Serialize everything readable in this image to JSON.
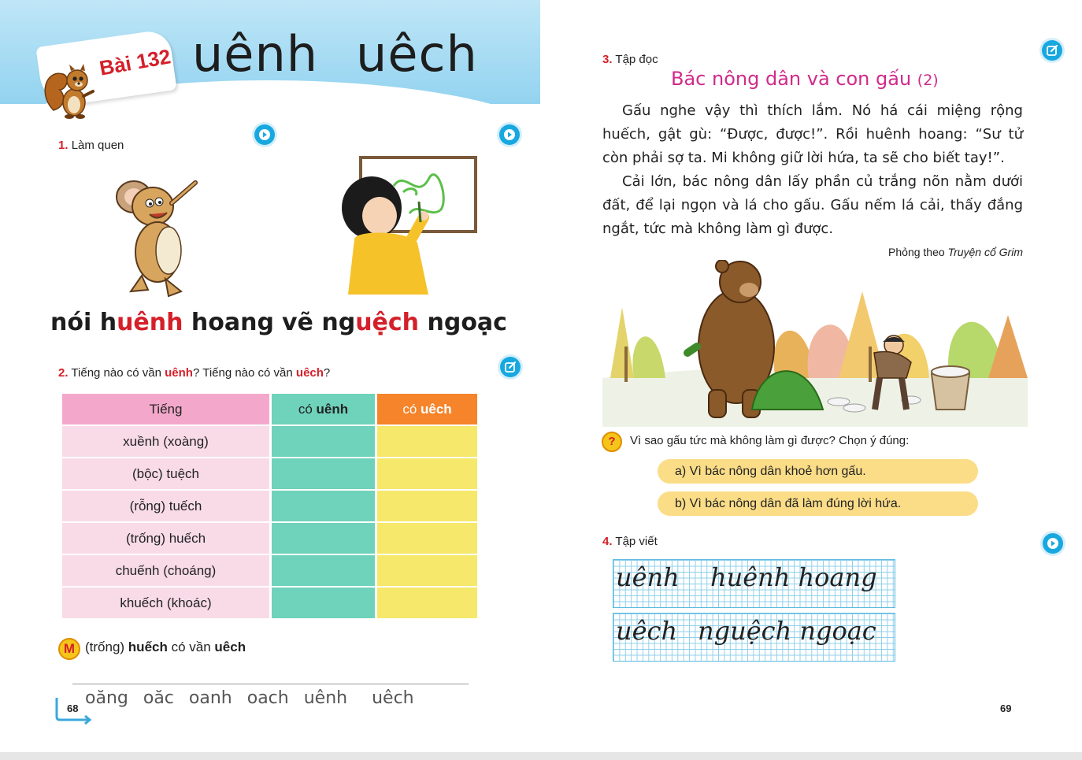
{
  "left_page": {
    "lesson_label": "Bài 132",
    "title_rhymes": [
      "uênh",
      "uêch"
    ],
    "section1": {
      "num": "1.",
      "title": "Làm quen"
    },
    "words": [
      {
        "pre": "nói h",
        "hl": "uênh",
        "post": " hoang"
      },
      {
        "pre": "vẽ ng",
        "hl": "uệch",
        "post": " ngoạc"
      }
    ],
    "section2": {
      "num": "2.",
      "q_a": "Tiếng nào có vần ",
      "rhyme_a": "uênh",
      "q_b": "? Tiếng nào có vần ",
      "rhyme_b": "uêch",
      "q_end": "?"
    },
    "table": {
      "headers": {
        "col1": "Tiếng",
        "col2_pre": "có ",
        "col2_hl": "uênh",
        "col3_pre": "có ",
        "col3_hl": "uêch"
      },
      "rows": [
        "xuềnh (xoàng)",
        "(bộc) tuệch",
        "(rỗng) tuếch",
        "(trống) huếch",
        "chuếnh (choáng)",
        "khuếch (khoác)"
      ]
    },
    "model": {
      "badge": "M",
      "pre": "(trống) ",
      "word": "huếch",
      "mid": " có vần ",
      "rhyme": "uêch"
    },
    "review_rhymes": [
      "oăng",
      "oăc",
      "oanh",
      "oach",
      "uênh",
      "uêch"
    ],
    "page_number": "68"
  },
  "right_page": {
    "section3": {
      "num": "3.",
      "title": "Tập đọc"
    },
    "story_title": "Bác nông dân và con gấu",
    "story_part": "(2)",
    "paragraphs": [
      "Gấu nghe vậy thì thích lắm. Nó há cái miệng rộng huếch, gật gù: “Được, được!”. Rồi huênh hoang: “Sư tử còn phải sợ ta. Mi không giữ lời hứa, ta sẽ cho biết tay!”.",
      "Cải lớn, bác nông dân lấy phần củ trắng nõn nằm dưới đất, để lại ngọn và lá cho gấu. Gấu nếm lá cải, thấy đắng ngắt, tức mà không làm gì được."
    ],
    "source_pre": "Phỏng theo ",
    "source_title": "Truyện cổ Grim",
    "question_icon": "?",
    "question": "Vì sao gấu tức mà không làm gì được? Chọn ý đúng:",
    "options": [
      "a)  Vì bác nông dân khoẻ hơn gấu.",
      "b)  Vì bác nông dân đã làm đúng lời hứa."
    ],
    "section4": {
      "num": "4.",
      "title": "Tập viết"
    },
    "writing": [
      [
        "uênh",
        "huênh hoang"
      ],
      [
        "uêch",
        "nguệch ngoạc"
      ]
    ],
    "page_number": "69"
  },
  "colors": {
    "accent_red": "#d4202a",
    "title_pink": "#d02a8a",
    "icon_blue": "#18a8e0",
    "header_blue": "#93d3f0"
  },
  "icons": [
    "play-icon",
    "edit-icon",
    "squirrel-mascot",
    "question-icon"
  ]
}
